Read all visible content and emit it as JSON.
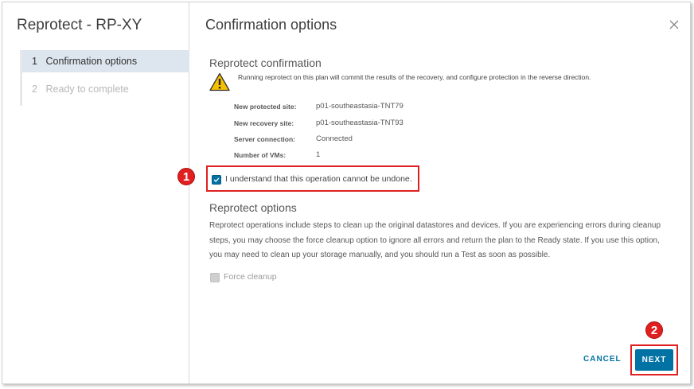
{
  "wizard": {
    "title": "Reprotect - RP-XY",
    "steps": [
      {
        "num": "1",
        "label": "Confirmation options",
        "state": "active"
      },
      {
        "num": "2",
        "label": "Ready to complete",
        "state": "disabled"
      }
    ]
  },
  "page": {
    "title": "Confirmation options",
    "confirmation": {
      "heading": "Reprotect confirmation",
      "warning": "Running reprotect on this plan will commit the results of the recovery, and configure protection in the reverse direction.",
      "details": [
        {
          "key": "New protected site:",
          "value": "p01-southeastasia-TNT79"
        },
        {
          "key": "New recovery site:",
          "value": "p01-southeastasia-TNT93"
        },
        {
          "key": "Server connection:",
          "value": "Connected"
        },
        {
          "key": "Number of VMs:",
          "value": "1"
        }
      ],
      "ack_label": "I understand that this operation cannot be undone.",
      "ack_checked": true
    },
    "options": {
      "heading": "Reprotect options",
      "description": "Reprotect operations include steps to clean up the original datastores and devices. If you are experiencing errors during cleanup steps, you may choose the force cleanup option to ignore all errors and return the plan to the Ready state. If you use this option, you may need to clean up your storage manually, and you should run a Test as soon as possible.",
      "force_cleanup_label": "Force cleanup",
      "force_cleanup_checked": false
    }
  },
  "footer": {
    "cancel_label": "CANCEL",
    "next_label": "NEXT"
  },
  "annotations": {
    "badge1": "1",
    "badge2": "2"
  },
  "colors": {
    "accent": "#0072a3",
    "highlight": "#e02020",
    "active_step_bg": "#dde5ee"
  },
  "icons": {
    "close": "close-icon",
    "warning": "warning-icon",
    "check": "checkmark-icon"
  }
}
